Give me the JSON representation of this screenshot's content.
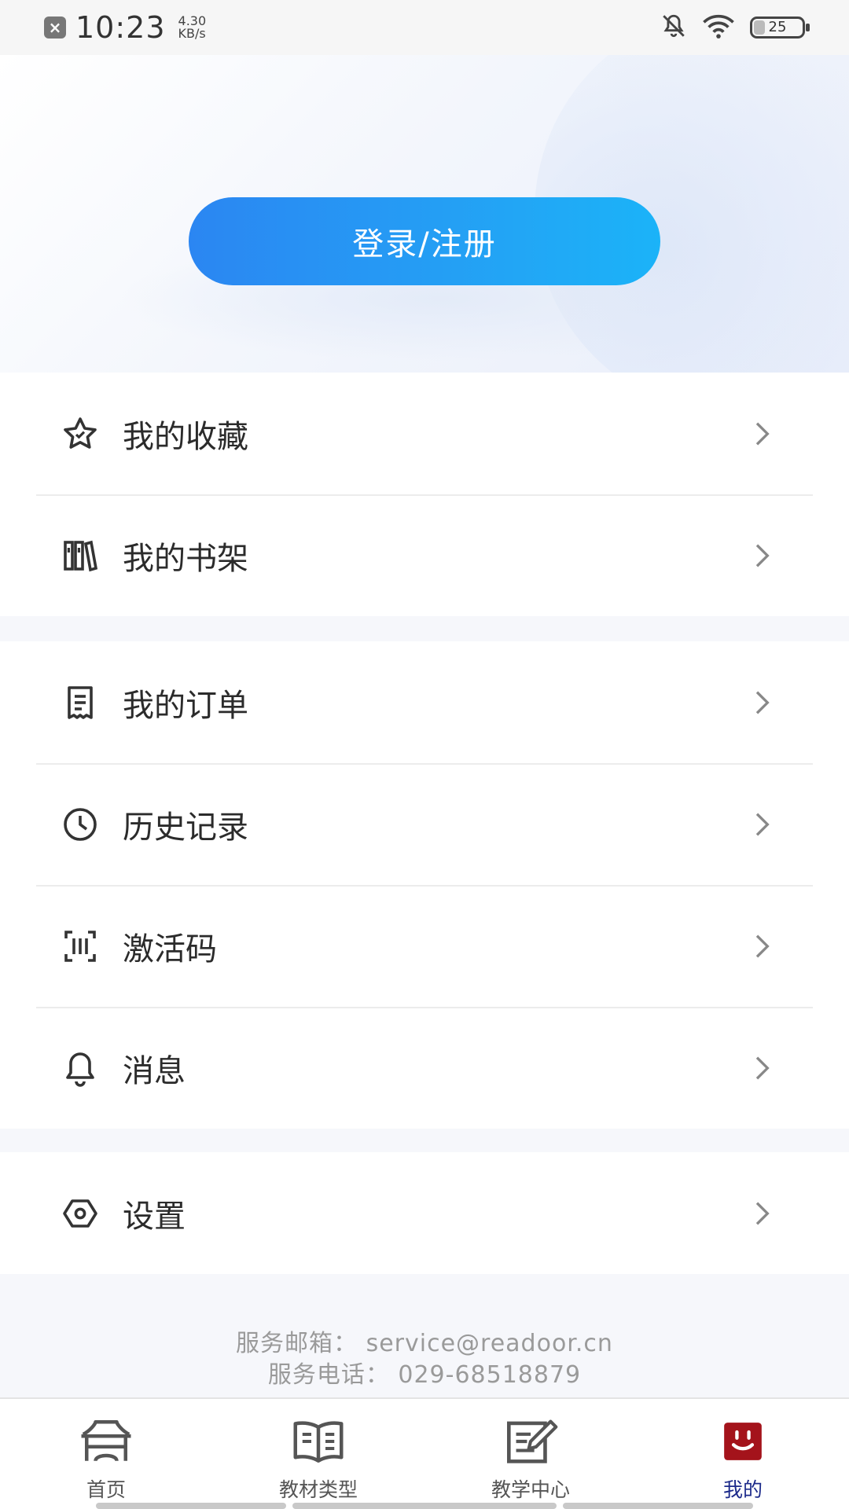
{
  "status_bar": {
    "time": "10:23",
    "net_speed_value": "4.30",
    "net_speed_unit": "KB/s",
    "battery_level": "25",
    "icons": [
      "notification-dismiss-icon",
      "mute-icon",
      "wifi-icon",
      "battery-icon"
    ]
  },
  "header": {
    "login_button_label": "登录/注册",
    "accent_gradient": [
      "#2b86f2",
      "#1bb3f8"
    ]
  },
  "menu_groups": [
    {
      "items": [
        {
          "label": "我的收藏",
          "icon": "star-icon"
        },
        {
          "label": "我的书架",
          "icon": "bookshelf-icon"
        }
      ]
    },
    {
      "items": [
        {
          "label": "我的订单",
          "icon": "order-icon"
        },
        {
          "label": "历史记录",
          "icon": "clock-icon"
        },
        {
          "label": "激活码",
          "icon": "scan-code-icon"
        },
        {
          "label": "消息",
          "icon": "bell-icon"
        }
      ]
    },
    {
      "items": [
        {
          "label": "设置",
          "icon": "settings-icon"
        }
      ]
    }
  ],
  "service": {
    "email_line": "服务邮箱： service@readoor.cn",
    "phone_line": "服务电话： 029-68518879"
  },
  "bottom_nav": {
    "items": [
      {
        "label": "首页",
        "icon": "home-icon",
        "active": false
      },
      {
        "label": "教材类型",
        "icon": "book-icon",
        "active": false
      },
      {
        "label": "教学中心",
        "icon": "edit-note-icon",
        "active": false
      },
      {
        "label": "我的",
        "icon": "profile-icon",
        "active": true
      }
    ],
    "active_color": "#1c2a8a",
    "profile_icon_color": "#a4131b"
  }
}
